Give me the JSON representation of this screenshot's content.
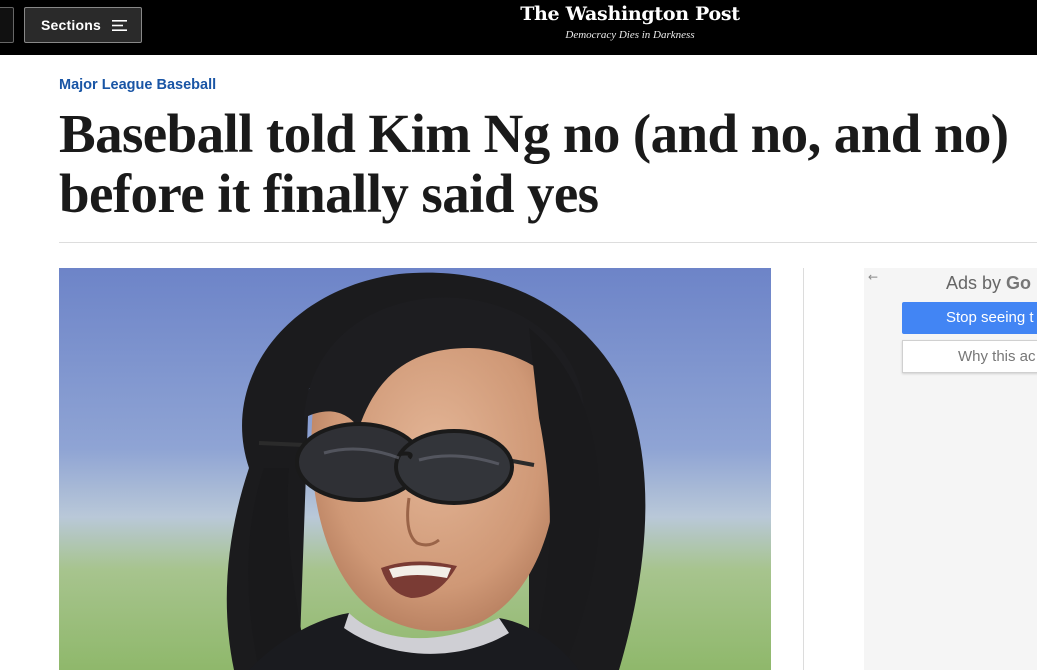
{
  "header": {
    "sections_label": "Sections",
    "logo_text": "The Washington Post",
    "tagline": "Democracy Dies in Darkness",
    "background_color": "#000000"
  },
  "article": {
    "kicker": "Major League Baseball",
    "kicker_color": "#1955a5",
    "headline_line1": "Baseball told Kim Ng no (and no, and no)",
    "headline_line2": "before it finally said yes",
    "photo_icon": "portrait-photo"
  },
  "ad": {
    "back_icon": "back-arrow-icon",
    "title_prefix": "Ads by ",
    "title_brand": "Go",
    "stop_label": "Stop seeing t",
    "why_label": "Why this ac",
    "button_color": "#4285f4"
  }
}
